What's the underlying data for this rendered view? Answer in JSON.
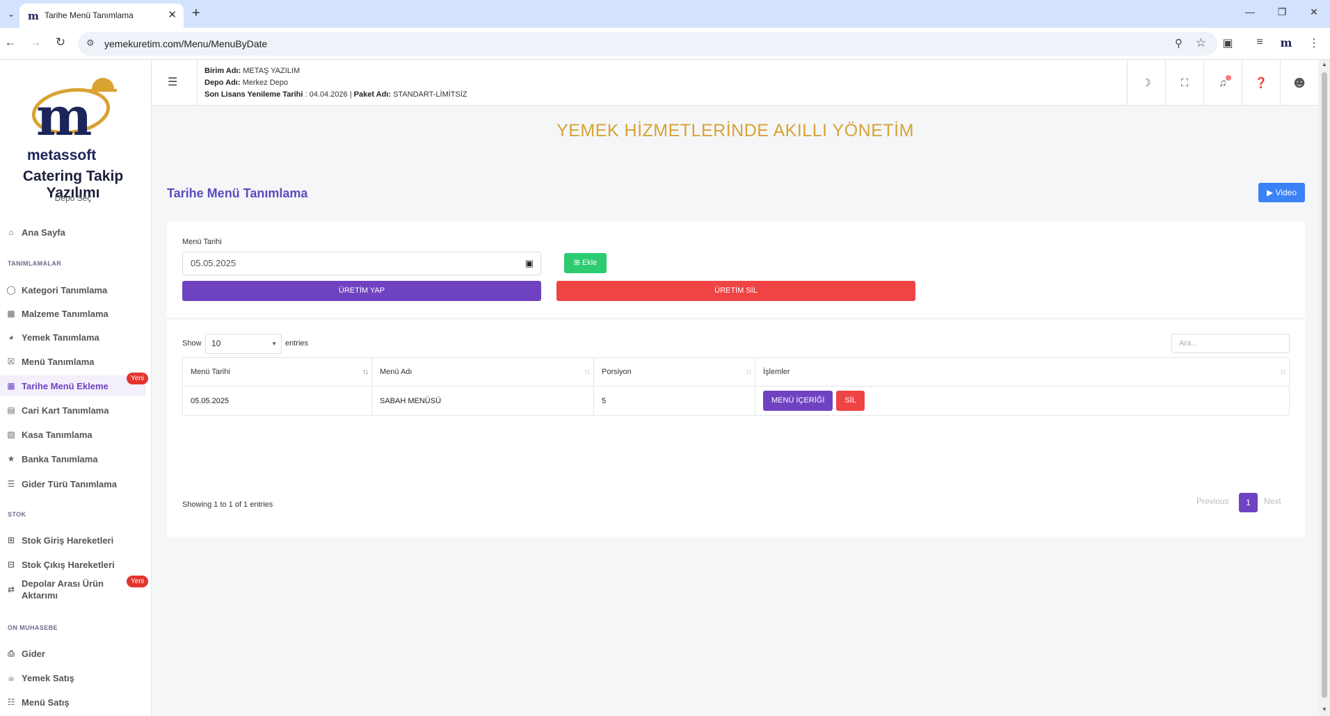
{
  "browser": {
    "tab_title": "Tarihe Menü Tanımlama",
    "favicon": "m",
    "url": "yemekuretim.com/Menu/MenuByDate"
  },
  "sidebar": {
    "brand_name": "metassoft",
    "app_title": "Catering Takip Yazılımı",
    "depo_sec": "Depo Seç",
    "home": "Ana Sayfa",
    "sections": {
      "tanimlamalar": "TANIMLAMALAR",
      "stok": "STOK",
      "on_muhasebe": "ON MUHASEBE"
    },
    "items": {
      "kategori": "Kategori Tanımlama",
      "malzeme": "Malzeme Tanımlama",
      "yemek": "Yemek Tanımlama",
      "menu": "Menü Tanımlama",
      "tarihe_menu": "Tarihe Menü Ekleme",
      "cari_kart": "Cari Kart Tanımlama",
      "kasa": "Kasa Tanımlama",
      "banka": "Banka Tanımlama",
      "gider_turu": "Gider Türü Tanımlama",
      "stok_giris": "Stok Giriş Hareketleri",
      "stok_cikis": "Stok Çıkış Hareketleri",
      "depolar_arasi_1": "Depolar Arası Ürün",
      "depolar_arasi_2": "Aktarımı",
      "gider": "Gider",
      "yemek_satis": "Yemek Satış",
      "menu_satis": "Menü Satış"
    },
    "badge_new": "Yeni"
  },
  "header": {
    "birim_label": "Birim Adı:",
    "birim_value": "METAŞ YAZILIM",
    "depo_label": "Depo Adı:",
    "depo_value": "Merkez Depo",
    "lisans_label": "Son Lisans Yenileme Tarihi",
    "lisans_value": ": 04.04.2026 |",
    "paket_label": "Paket Adı:",
    "paket_value": "STANDART-LİMİTSİZ"
  },
  "slogan": "YEMEK HİZMETLERİNDE AKILLI YÖNETİM",
  "page_title": "Tarihe Menü Tanımlama",
  "video_button": "Video",
  "form": {
    "date_label": "Menü Tarihi",
    "date_value": "05.05.2025",
    "ekle_button": "Ekle",
    "uretim_yap_button": "ÜRETİM YAP",
    "uretim_sil_button": "ÜRETİM SİL"
  },
  "table": {
    "show_label": "Show",
    "page_length": "10",
    "entries_label": "entries",
    "search_placeholder": "Ara...",
    "columns": [
      "Menü Tarihi",
      "Menü Adı",
      "Porsiyon",
      "İşlemler"
    ],
    "rows": [
      {
        "tarih": "05.05.2025",
        "ad": "SABAH MENÜSÜ",
        "porsiyon": "5"
      }
    ],
    "row_actions": {
      "content": "MENÜ İÇERİĞİ",
      "delete": "SİL"
    },
    "info": "Showing 1 to 1 of 1 entries",
    "pagination": {
      "previous": "Previous",
      "current": "1",
      "next": "Next"
    }
  },
  "colors": {
    "accent": "#6f42c1",
    "danger": "#ef4444",
    "success": "#2ecc71",
    "info": "#3b82f6",
    "slogan": "#d9a233"
  }
}
